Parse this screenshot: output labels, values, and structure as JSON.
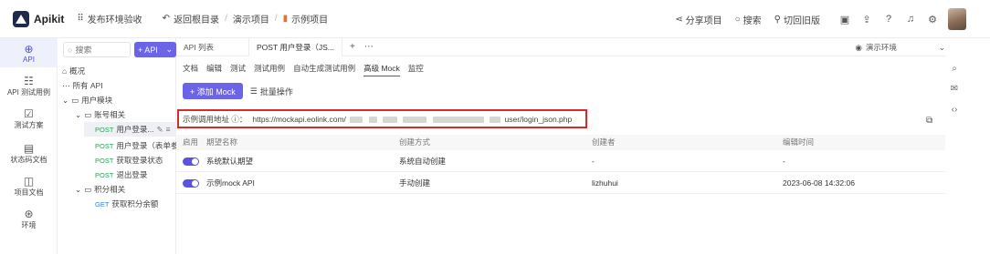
{
  "app": {
    "brand": "Apikit",
    "workspace": "发布环境验收",
    "breadcrumbs": [
      "返回根目录",
      "演示项目",
      "示例项目"
    ]
  },
  "topbar": {
    "share": "分享项目",
    "search": "搜索",
    "back_old": "切回旧版"
  },
  "leftnav": {
    "items": [
      {
        "label": "API",
        "icon": "api-icon"
      },
      {
        "label": "API 测试用例",
        "icon": "test-case-icon"
      },
      {
        "label": "测试方案",
        "icon": "test-plan-icon"
      },
      {
        "label": "状态码文档",
        "icon": "status-doc-icon"
      },
      {
        "label": "项目文档",
        "icon": "project-doc-icon"
      },
      {
        "label": "环境",
        "icon": "env-icon"
      }
    ]
  },
  "tree": {
    "search_placeholder": "搜索",
    "add_label": "+ API",
    "nodes": [
      {
        "label": "概况"
      },
      {
        "label": "所有 API"
      },
      {
        "label": "用户模块"
      },
      {
        "label": "账号相关"
      },
      {
        "method": "POST",
        "label": "用户登录..."
      },
      {
        "method": "POST",
        "label": "用户登录（表单参..."
      },
      {
        "method": "POST",
        "label": "获取登录状态"
      },
      {
        "method": "POST",
        "label": "退出登录"
      },
      {
        "label": "积分相关"
      },
      {
        "method": "GET",
        "label": "获取积分余额"
      }
    ]
  },
  "tabs": {
    "items": [
      "API 列表",
      "POST 用户登录（JS..."
    ],
    "active_index": 1,
    "env_label": "演示环境"
  },
  "subtabs": {
    "items": [
      "文档",
      "编辑",
      "测试",
      "测试用例",
      "自动生成测试用例",
      "高级 Mock",
      "监控"
    ],
    "active_index": 5
  },
  "actions": {
    "add_mock": "+ 添加 Mock",
    "batch": "批量操作"
  },
  "mock_url": {
    "label": "示例调用地址 ⓘ：",
    "prefix": "https://mockapi.eolink.com/",
    "suffix": "user/login_json.php"
  },
  "table": {
    "headers": [
      "启用",
      "期望名称",
      "创建方式",
      "创建者",
      "编辑时间"
    ],
    "rows": [
      {
        "enabled": true,
        "name": "系统默认期望",
        "method": "系统自动创建",
        "creator": "-",
        "time": "-"
      },
      {
        "enabled": true,
        "name": "示例mock API",
        "method": "手动创建",
        "creator": "lizhuhui",
        "time": "2023-06-08 14:32:06"
      }
    ]
  },
  "colors": {
    "accent": "#6b63e8",
    "highlight_border": "#d62b2b",
    "post": "#2e9e5b",
    "get": "#2f7fd6"
  }
}
